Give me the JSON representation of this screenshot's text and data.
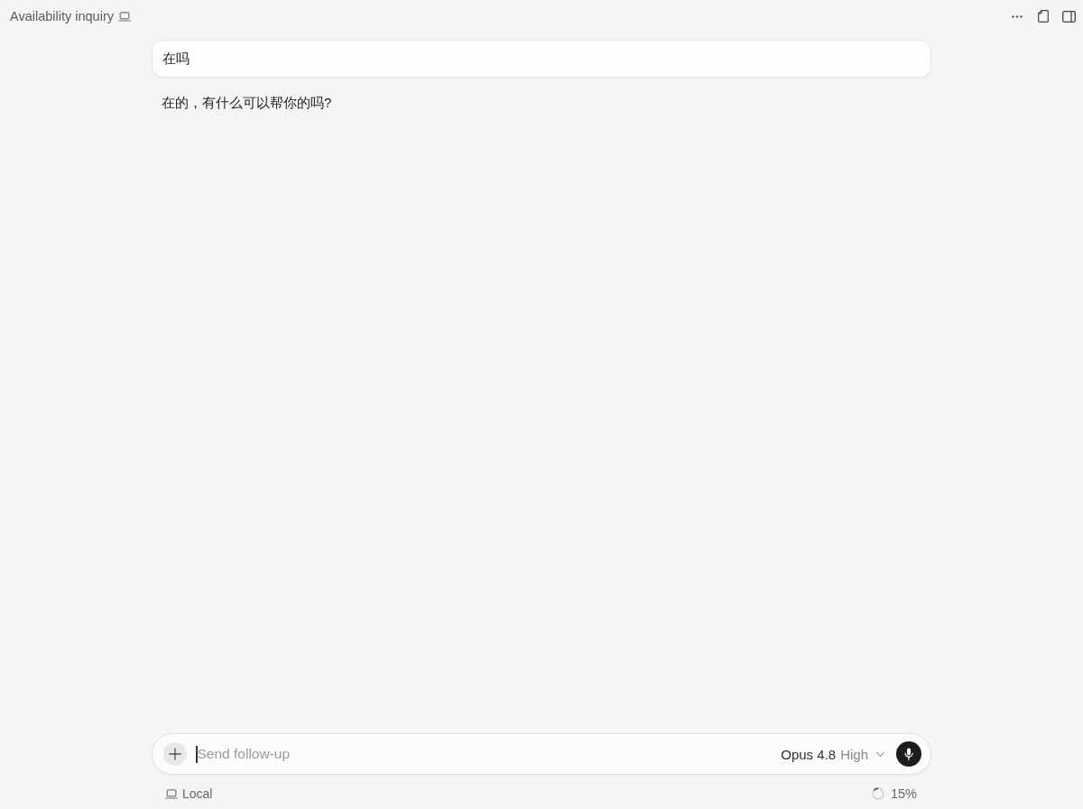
{
  "window": {
    "title": "Availability inquiry"
  },
  "messages": [
    {
      "kind": "user",
      "text": "在吗"
    },
    {
      "kind": "assistant",
      "text": "在的，有什么可以帮你的吗?"
    }
  ],
  "composer": {
    "placeholder": "Send follow-up",
    "focused": true,
    "model": "Opus 4.8",
    "effort": "High"
  },
  "footer": {
    "location": "Local",
    "usage": {
      "level": 0.15,
      "reading": "15%"
    }
  }
}
